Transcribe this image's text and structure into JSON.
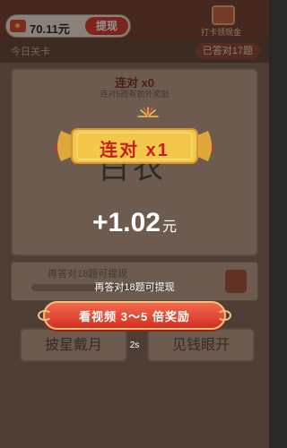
{
  "header": {
    "coin_amount": "70.11元",
    "withdraw_label": "提现",
    "signin_label": "打卡领现金",
    "signin_icon": "calendar-icon",
    "wallet_icon": "red-envelope-icon"
  },
  "subheader": {
    "left_text": "今日关卡",
    "right_text": "已答对17题"
  },
  "question": {
    "title": "连对 x0",
    "subtitle": "连对5题有额外奖励",
    "answer_chars": "白衣"
  },
  "progress_card": {
    "text": "再答对18题可提现",
    "icon": "treasure-chest-icon"
  },
  "options": [
    "披星戴月",
    "见钱眼开"
  ],
  "popup": {
    "banner_text": "连对 x1",
    "reward_amount": "+1.02",
    "reward_unit": "元",
    "hint_text": "再答对18题可提现",
    "video_button_label": "看视频 3～5 倍奖励",
    "countdown": "2s",
    "fireworks_icon": "fireworks-icon"
  },
  "colors": {
    "accent_red": "#d52f22",
    "banner_gold": "#f2c84b",
    "overlay": "#14100e"
  }
}
